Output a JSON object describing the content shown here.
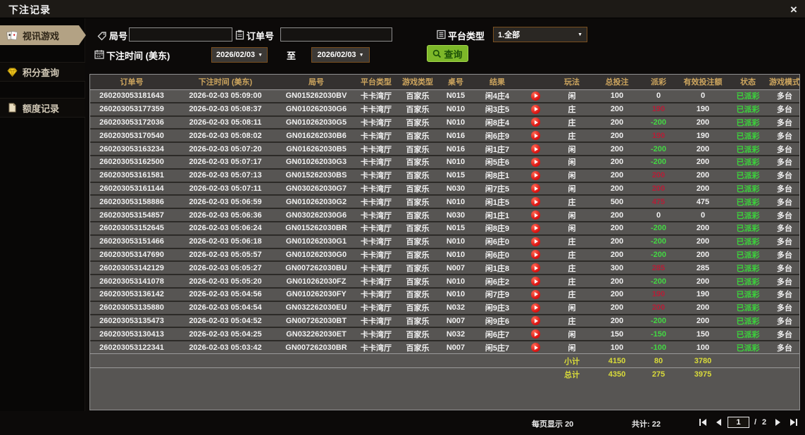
{
  "window": {
    "title": "下注记录",
    "close_glyph": "×"
  },
  "colors": {
    "accent_tan": "#b3a284",
    "header_gold": "#cda55e",
    "pos_red": "#b51e37",
    "neg_green": "#43d843",
    "status_green": "#3bd43b",
    "totals_yellow": "#d9db3a",
    "btn_green": "#7db829",
    "btn_text": "#1d5208"
  },
  "sidebar": {
    "items": [
      {
        "label": "视讯游戏",
        "icon": "playing-cards",
        "active": true
      },
      {
        "label": "积分查询",
        "icon": "gem",
        "active": false
      },
      {
        "label": "额度记录",
        "icon": "document",
        "active": false
      }
    ]
  },
  "filters": {
    "round_label": "局号",
    "round_value": "",
    "order_label": "订单号",
    "order_value": "",
    "platform_label": "平台类型",
    "platform_value": "1.全部",
    "time_label": "下注时间 (美东)",
    "date_from": "2026/02/03",
    "to_label": "至",
    "date_to": "2026/02/03",
    "search_button": "查询"
  },
  "table": {
    "headers": [
      "订单号",
      "下注时间 (美东)",
      "局号",
      "平台类型",
      "游戏类型",
      "桌号",
      "结果",
      "",
      "玩法",
      "总投注",
      "派彩",
      "有效投注额",
      "状态",
      "游戏模式"
    ],
    "rows": [
      [
        "260203053181643",
        "2026-02-03 05:09:00",
        "GN015262030BV",
        "卡卡湾厅",
        "百家乐",
        "N015",
        "闲4庄4",
        "闲",
        "100",
        "0",
        "0",
        "已派彩",
        "多台"
      ],
      [
        "260203053177359",
        "2026-02-03 05:08:37",
        "GN010262030G6",
        "卡卡湾厅",
        "百家乐",
        "N010",
        "闲3庄5",
        "庄",
        "200",
        "190",
        "190",
        "已派彩",
        "多台"
      ],
      [
        "260203053172036",
        "2026-02-03 05:08:11",
        "GN010262030G5",
        "卡卡湾厅",
        "百家乐",
        "N010",
        "闲8庄4",
        "庄",
        "200",
        "-200",
        "200",
        "已派彩",
        "多台"
      ],
      [
        "260203053170540",
        "2026-02-03 05:08:02",
        "GN016262030B6",
        "卡卡湾厅",
        "百家乐",
        "N016",
        "闲6庄9",
        "庄",
        "200",
        "190",
        "190",
        "已派彩",
        "多台"
      ],
      [
        "260203053163234",
        "2026-02-03 05:07:20",
        "GN016262030B5",
        "卡卡湾厅",
        "百家乐",
        "N016",
        "闲1庄7",
        "闲",
        "200",
        "-200",
        "200",
        "已派彩",
        "多台"
      ],
      [
        "260203053162500",
        "2026-02-03 05:07:17",
        "GN010262030G3",
        "卡卡湾厅",
        "百家乐",
        "N010",
        "闲5庄6",
        "闲",
        "200",
        "-200",
        "200",
        "已派彩",
        "多台"
      ],
      [
        "260203053161581",
        "2026-02-03 05:07:13",
        "GN015262030BS",
        "卡卡湾厅",
        "百家乐",
        "N015",
        "闲8庄1",
        "闲",
        "200",
        "200",
        "200",
        "已派彩",
        "多台"
      ],
      [
        "260203053161144",
        "2026-02-03 05:07:11",
        "GN030262030G7",
        "卡卡湾厅",
        "百家乐",
        "N030",
        "闲7庄5",
        "闲",
        "200",
        "200",
        "200",
        "已派彩",
        "多台"
      ],
      [
        "260203053158886",
        "2026-02-03 05:06:59",
        "GN010262030G2",
        "卡卡湾厅",
        "百家乐",
        "N010",
        "闲1庄5",
        "庄",
        "500",
        "475",
        "475",
        "已派彩",
        "多台"
      ],
      [
        "260203053154857",
        "2026-02-03 05:06:36",
        "GN030262030G6",
        "卡卡湾厅",
        "百家乐",
        "N030",
        "闲1庄1",
        "闲",
        "200",
        "0",
        "0",
        "已派彩",
        "多台"
      ],
      [
        "260203053152645",
        "2026-02-03 05:06:24",
        "GN015262030BR",
        "卡卡湾厅",
        "百家乐",
        "N015",
        "闲8庄9",
        "闲",
        "200",
        "-200",
        "200",
        "已派彩",
        "多台"
      ],
      [
        "260203053151466",
        "2026-02-03 05:06:18",
        "GN010262030G1",
        "卡卡湾厅",
        "百家乐",
        "N010",
        "闲6庄0",
        "庄",
        "200",
        "-200",
        "200",
        "已派彩",
        "多台"
      ],
      [
        "260203053147690",
        "2026-02-03 05:05:57",
        "GN010262030G0",
        "卡卡湾厅",
        "百家乐",
        "N010",
        "闲6庄0",
        "庄",
        "200",
        "-200",
        "200",
        "已派彩",
        "多台"
      ],
      [
        "260203053142129",
        "2026-02-03 05:05:27",
        "GN007262030BU",
        "卡卡湾厅",
        "百家乐",
        "N007",
        "闲1庄8",
        "庄",
        "300",
        "285",
        "285",
        "已派彩",
        "多台"
      ],
      [
        "260203053141078",
        "2026-02-03 05:05:20",
        "GN010262030FZ",
        "卡卡湾厅",
        "百家乐",
        "N010",
        "闲6庄2",
        "庄",
        "200",
        "-200",
        "200",
        "已派彩",
        "多台"
      ],
      [
        "260203053136142",
        "2026-02-03 05:04:56",
        "GN010262030FY",
        "卡卡湾厅",
        "百家乐",
        "N010",
        "闲7庄9",
        "庄",
        "200",
        "190",
        "190",
        "已派彩",
        "多台"
      ],
      [
        "260203053135880",
        "2026-02-03 05:04:54",
        "GN032262030EU",
        "卡卡湾厅",
        "百家乐",
        "N032",
        "闲9庄3",
        "闲",
        "200",
        "200",
        "200",
        "已派彩",
        "多台"
      ],
      [
        "260203053135473",
        "2026-02-03 05:04:52",
        "GN007262030BT",
        "卡卡湾厅",
        "百家乐",
        "N007",
        "闲9庄6",
        "庄",
        "200",
        "-200",
        "200",
        "已派彩",
        "多台"
      ],
      [
        "260203053130413",
        "2026-02-03 05:04:25",
        "GN032262030ET",
        "卡卡湾厅",
        "百家乐",
        "N032",
        "闲6庄7",
        "闲",
        "150",
        "-150",
        "150",
        "已派彩",
        "多台"
      ],
      [
        "260203053122341",
        "2026-02-03 05:03:42",
        "GN007262030BR",
        "卡卡湾厅",
        "百家乐",
        "N007",
        "闲5庄7",
        "闲",
        "100",
        "-100",
        "100",
        "已派彩",
        "多台"
      ]
    ],
    "subtotal": {
      "label": "小计",
      "total_bet": "4150",
      "payout": "80",
      "valid_bet": "3780"
    },
    "total": {
      "label": "总计",
      "total_bet": "4350",
      "payout": "275",
      "valid_bet": "3975"
    }
  },
  "pagination": {
    "per_page_label": "每页显示",
    "per_page": "20",
    "total_label": "共计:",
    "total_count": "22",
    "current_page": "1",
    "page_separator": "/",
    "total_pages": "2"
  }
}
